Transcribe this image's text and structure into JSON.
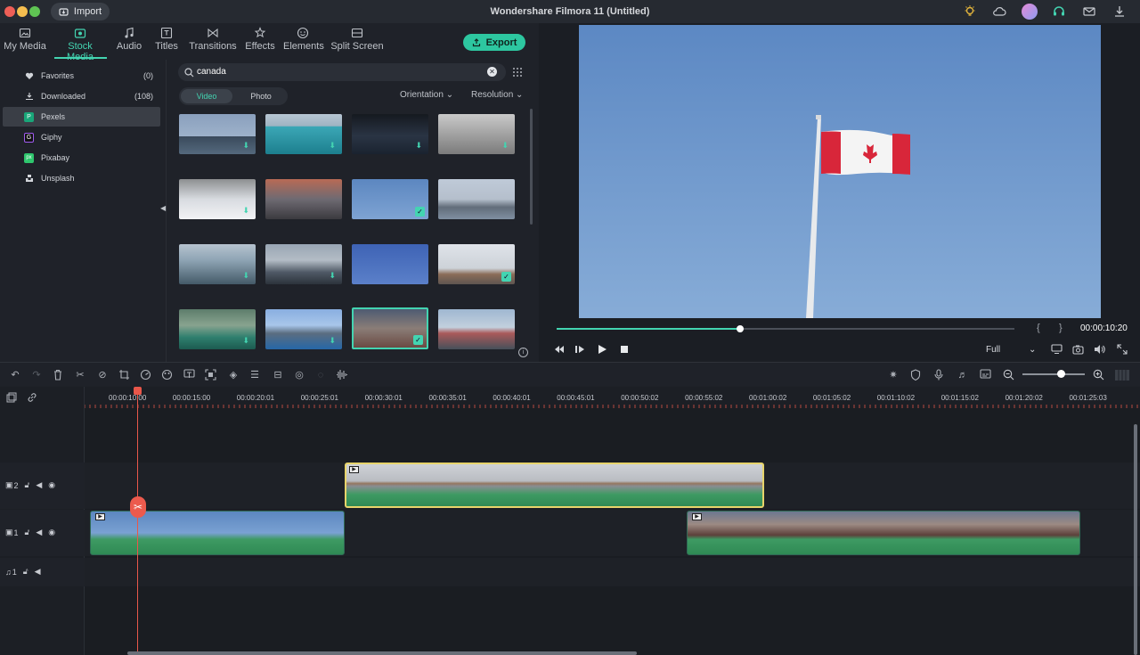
{
  "app": {
    "title": "Wondershare Filmora 11 (Untitled)",
    "import_label": "Import",
    "export_label": "Export"
  },
  "tabs": [
    {
      "label": "My Media",
      "icon": "folder-icon"
    },
    {
      "label": "Stock Media",
      "icon": "stock-media-icon",
      "active": true
    },
    {
      "label": "Audio",
      "icon": "music-note-icon"
    },
    {
      "label": "Titles",
      "icon": "titles-icon"
    },
    {
      "label": "Transitions",
      "icon": "transitions-icon"
    },
    {
      "label": "Effects",
      "icon": "effects-icon"
    },
    {
      "label": "Elements",
      "icon": "elements-icon"
    },
    {
      "label": "Split Screen",
      "icon": "split-screen-icon"
    }
  ],
  "sidebar": {
    "items": [
      {
        "label": "Favorites",
        "count": "(0)",
        "icon": "heart-icon"
      },
      {
        "label": "Downloaded",
        "count": "(108)",
        "icon": "download-icon"
      },
      {
        "label": "Pexels",
        "count": "",
        "icon": "pexels-icon",
        "selected": true
      },
      {
        "label": "Giphy",
        "count": "",
        "icon": "giphy-icon"
      },
      {
        "label": "Pixabay",
        "count": "",
        "icon": "pixabay-icon"
      },
      {
        "label": "Unsplash",
        "count": "",
        "icon": "unsplash-icon"
      }
    ]
  },
  "search": {
    "value": "canada"
  },
  "filters": {
    "video": "Video",
    "photo": "Photo",
    "orientation": "Orientation",
    "resolution": "Resolution"
  },
  "preview": {
    "timecode": "00:00:10:20",
    "zoom": "Full",
    "progress": 0.4,
    "brace_open": "{",
    "brace_close": "}"
  },
  "timeline": {
    "ruler_labels": [
      "00:00:10:00",
      "00:00:15:00",
      "00:00:20:01",
      "00:00:25:01",
      "00:00:30:01",
      "00:00:35:01",
      "00:00:40:01",
      "00:00:45:01",
      "00:00:50:02",
      "00:00:55:02",
      "00:01:00:02",
      "00:01:05:02",
      "00:01:10:02",
      "00:01:15:02",
      "00:01:20:02",
      "00:01:25:03"
    ],
    "tracks": [
      {
        "label": "2"
      },
      {
        "label": "1"
      },
      {
        "label": "1"
      }
    ]
  },
  "colors": {
    "accent": "#43d4b1",
    "playhead": "#e9574a",
    "clip_selected_border": "#e7d46b"
  }
}
